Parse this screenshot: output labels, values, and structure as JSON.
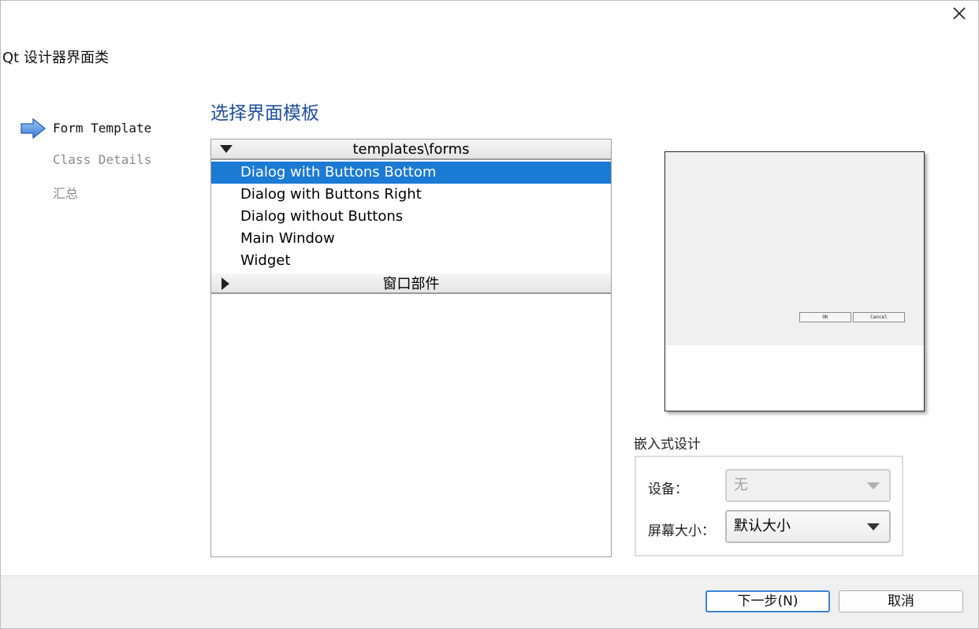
{
  "window": {
    "title": "Qt 设计器界面类"
  },
  "steps": [
    {
      "label": "Form Template",
      "current": true
    },
    {
      "label": "Class Details",
      "current": false
    },
    {
      "label": "汇总",
      "current": false
    }
  ],
  "page": {
    "heading": "选择界面模板"
  },
  "templates": {
    "group_forms": "templates\\forms",
    "items": [
      "Dialog with Buttons Bottom",
      "Dialog with Buttons Right",
      "Dialog without Buttons",
      "Main Window",
      "Widget"
    ],
    "selected_index": 0,
    "group_widgets": "窗口部件"
  },
  "preview": {
    "ok_label": "OK",
    "cancel_label": "Cancel"
  },
  "embedded": {
    "title": "嵌入式设计",
    "device_label": "设备：",
    "device_value": "无",
    "screen_label": "屏幕大小：",
    "screen_value": "默认大小"
  },
  "buttons": {
    "next": "下一步(N)",
    "cancel": "取消"
  },
  "colors": {
    "accent": "#1a7ad4",
    "heading": "#1f4e9b"
  }
}
